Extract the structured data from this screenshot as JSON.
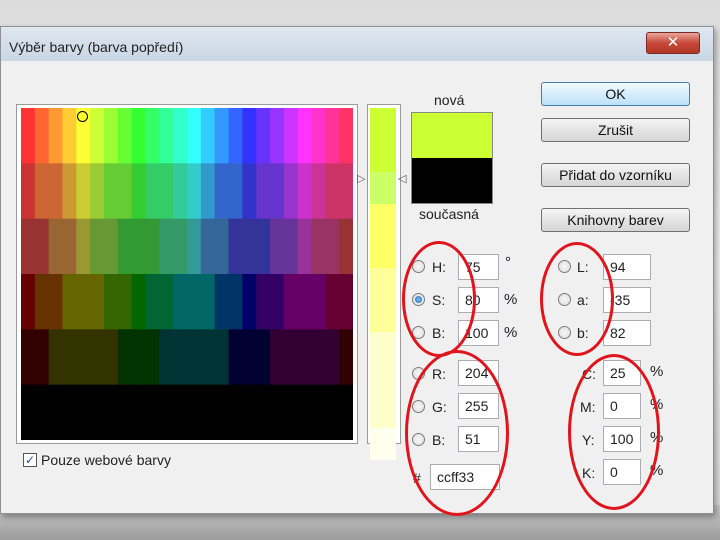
{
  "dialog": {
    "title": "Výběr barvy (barva popředí)",
    "close_symbol": "✕"
  },
  "swatch": {
    "new_label": "nová",
    "current_label": "současná",
    "new_color": "#ccff33",
    "current_color": "#000000"
  },
  "buttons": {
    "ok": "OK",
    "cancel": "Zrušit",
    "add_swatch": "Přidat do vzorníku",
    "libraries": "Knihovny barev"
  },
  "hsb": {
    "h": {
      "label": "H:",
      "value": "75",
      "unit": "°"
    },
    "s": {
      "label": "S:",
      "value": "80",
      "unit": "%"
    },
    "b": {
      "label": "B:",
      "value": "100",
      "unit": "%"
    }
  },
  "lab": {
    "l": {
      "label": "L:",
      "value": "94"
    },
    "a": {
      "label": "a:",
      "value": "-35"
    },
    "b": {
      "label": "b:",
      "value": "82"
    }
  },
  "rgb": {
    "r": {
      "label": "R:",
      "value": "204"
    },
    "g": {
      "label": "G:",
      "value": "255"
    },
    "b": {
      "label": "B:",
      "value": "51"
    }
  },
  "cmyk": {
    "c": {
      "label": "C:",
      "value": "25",
      "unit": "%"
    },
    "m": {
      "label": "M:",
      "value": "0",
      "unit": "%"
    },
    "y": {
      "label": "Y:",
      "value": "100",
      "unit": "%"
    },
    "k": {
      "label": "K:",
      "value": "0",
      "unit": "%"
    }
  },
  "hex": {
    "label": "#",
    "value": "ccff33"
  },
  "web_only": {
    "label": "Pouze webové barvy",
    "checked": true,
    "check_mark": "✓"
  },
  "selected_mode": "S",
  "accent_annotation_color": "#e0141c"
}
